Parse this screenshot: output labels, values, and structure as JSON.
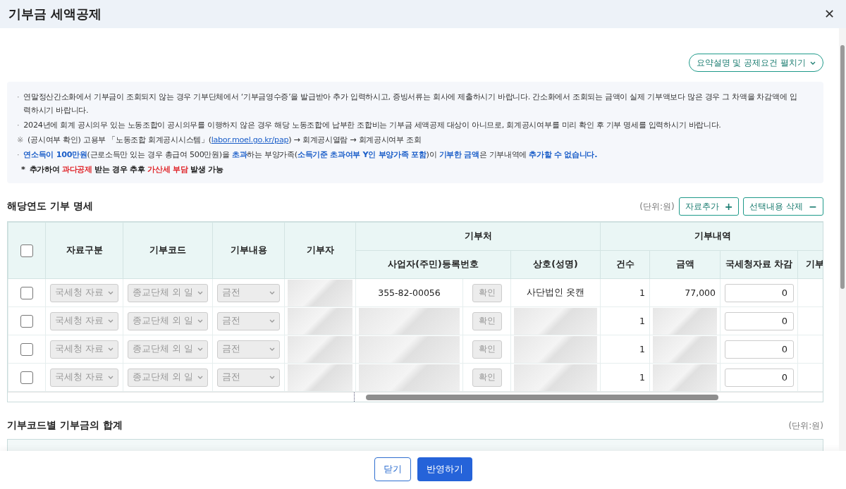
{
  "dialog": {
    "title": "기부금 세액공제",
    "close": "✕"
  },
  "expand_button": {
    "label": "요약설명 및 공제요건 펼치기"
  },
  "notice": [
    {
      "marker": "·",
      "segments": [
        {
          "text": "연말정산간소화에서 기부금이 조회되지 않는 경우 기부단체에서 ‘기부금영수증’을 발급받아 추가 입력하시고, 증빙서류는 회사에 제출하시기 바랍니다. 간소화에서 조회되는 금액이 실제 기부액보다 많은 경우 그 차액을 차감액에 입력하시기 바랍니다.",
          "kind": "plain"
        }
      ]
    },
    {
      "marker": "·",
      "segments": [
        {
          "text": "2024년에 회계 공시의무 있는 노동조합이 공시의무를 이행하지 않은 경우 해당 노동조합에 납부한 조합비는 기부금 세액공제 대상이 아니므로, 회계공시여부를 미리 확인 후 기부 명세를 입력하시기 바랍니다.",
          "kind": "plain"
        }
      ]
    },
    {
      "marker": "※",
      "segments": [
        {
          "text": "(공시여부 확인) 고용부 「노동조합 회계공시시스템」(",
          "kind": "plain"
        },
        {
          "text": "labor.moel.go.kr/pap",
          "kind": "link"
        },
        {
          "text": ") → 회계공시열람 → 회계공시여부 조회",
          "kind": "plain"
        }
      ]
    },
    {
      "marker": "·",
      "segments": [
        {
          "text": "연소득이 100만원",
          "kind": "blue"
        },
        {
          "text": "(근로소득만 있는 경우 총급여 500만원)을 ",
          "kind": "plain"
        },
        {
          "text": "초과",
          "kind": "blue"
        },
        {
          "text": "하는 부양가족(",
          "kind": "plain"
        },
        {
          "text": "소득기준 초과여부 Y인 부양가족 포함",
          "kind": "blue"
        },
        {
          "text": ")이 ",
          "kind": "plain"
        },
        {
          "text": "기부한 금액",
          "kind": "blue"
        },
        {
          "text": "은 기부내역에 ",
          "kind": "plain"
        },
        {
          "text": "추가할 수 없습니다.",
          "kind": "blue"
        }
      ]
    },
    {
      "marker": "*",
      "segments": [
        {
          "text": "추가하여 ",
          "kind": "strong"
        },
        {
          "text": "과다공제",
          "kind": "red"
        },
        {
          "text": " 받는 경우 추후 ",
          "kind": "strong"
        },
        {
          "text": "가산세 부담",
          "kind": "red"
        },
        {
          "text": " 발생 가능",
          "kind": "strong"
        }
      ]
    }
  ],
  "details": {
    "title": "해당연도 기부 명세",
    "unit": "(단위:원)",
    "add_button": {
      "label": "자료추가",
      "icon": "+"
    },
    "delete_button": {
      "label": "선택내용 삭제",
      "icon": "−"
    },
    "header_checked": false,
    "columns": {
      "source": "자료구분",
      "code": "기부코드",
      "content": "기부내용",
      "donor": "기부자",
      "recipient": "기부처",
      "reg_no": "사업자(주민)등록번호",
      "name": "상호(성명)",
      "history": "기부내역",
      "count": "건수",
      "amount": "금액",
      "deduct": "국세청자료 차감",
      "column_11": "기부"
    },
    "rows": [
      {
        "checked": false,
        "source": "국세청 자료",
        "code": "종교단체 외 일",
        "content": "금전",
        "donor": {
          "kind": "blurred"
        },
        "reg_no": "355-82-00056",
        "verify": "확인",
        "name": "사단법인 옷캔",
        "count": "1",
        "amount": "77,000",
        "deduct": "0"
      },
      {
        "checked": false,
        "source": "국세청 자료",
        "code": "종교단체 외 일",
        "content": "금전",
        "donor": {
          "kind": "blurred"
        },
        "reg_no": {
          "kind": "blurred"
        },
        "verify": "확인",
        "name": {
          "kind": "blurred"
        },
        "count": "1",
        "amount": {
          "kind": "blurred"
        },
        "deduct": "0"
      },
      {
        "checked": false,
        "source": "국세청 자료",
        "code": "종교단체 외 일",
        "content": "금전",
        "donor": {
          "kind": "blurred"
        },
        "reg_no": {
          "kind": "blurred"
        },
        "verify": "확인",
        "name": {
          "kind": "blurred"
        },
        "count": "1",
        "amount": {
          "kind": "blurred"
        },
        "deduct": "0"
      },
      {
        "checked": false,
        "source": "국세청 자료",
        "code": "종교단체 외 일",
        "content": "금전",
        "donor": {
          "kind": "blurred"
        },
        "reg_no": {
          "kind": "blurred"
        },
        "verify": "확인",
        "name": {
          "kind": "blurred"
        },
        "count": "1",
        "amount": {
          "kind": "blurred"
        },
        "deduct": "0"
      }
    ]
  },
  "summary": {
    "title": "기부코드별 기부금의 합계",
    "unit": "(단위:원)"
  },
  "footer": {
    "close": "닫기",
    "apply": "반영하기"
  }
}
